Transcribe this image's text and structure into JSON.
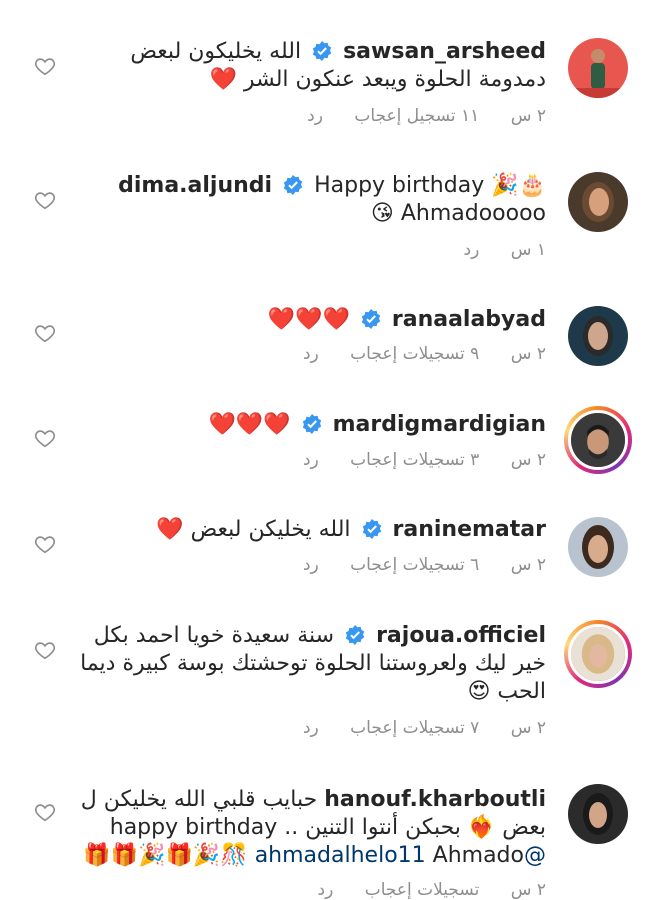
{
  "comments": [
    {
      "username": "sawsan_arsheed",
      "text": "الله يخليكون لبعض دمدومة الحلوة ويبعد عنكون الشر ❤️",
      "time": "٢ س",
      "likes": "١١ تسجيل إعجاب",
      "reply": "رد"
    },
    {
      "username": "dima.aljundi",
      "text": "Happy birthday 🎉🎂 Ahmadooooo 😘",
      "time": "١ س",
      "likes": "",
      "reply": "رد"
    },
    {
      "username": "ranaalabyad",
      "text": "❤️❤️❤️",
      "time": "٢ س",
      "likes": "٩ تسجيلات إعجاب",
      "reply": "رد"
    },
    {
      "username": "mardigmardigian",
      "text": "❤️❤️❤️",
      "time": "٢ س",
      "likes": "٣ تسجيلات إعجاب",
      "reply": "رد"
    },
    {
      "username": "raninematar",
      "text": "الله يخليكن لبعض ❤️",
      "time": "٢ س",
      "likes": "٦ تسجيلات إعجاب",
      "reply": "رد"
    },
    {
      "username": "rajoua.officiel",
      "text": "سنة سعيدة خويا احمد بكل خير ليك ولعروستنا الحلوة توحشتك بوسة كبيرة ديما الحب 😍",
      "time": "٢ س",
      "likes": "٧ تسجيلات إعجاب",
      "reply": "رد"
    },
    {
      "username": "hanouf.kharboutli",
      "text_line1": "حبايب قلبي الله يخليكن ل",
      "text_line2": "بعض ❤️‍🔥 بحبكن أنتوا التنين .. happy birthday",
      "mention": "@ahmadalhelo11",
      "text_line3": "Ahmado 🎊🎉🎁🎉🎁🎁",
      "time": "٢ س",
      "likes": "تسجيلات إعجاب",
      "reply": "رد"
    }
  ],
  "icons": {
    "verified": "verified-badge-icon",
    "like": "heart-outline-icon"
  },
  "colors": {
    "verified": "#3897f0",
    "meta": "#8e8e8e",
    "mention": "#00376b"
  }
}
